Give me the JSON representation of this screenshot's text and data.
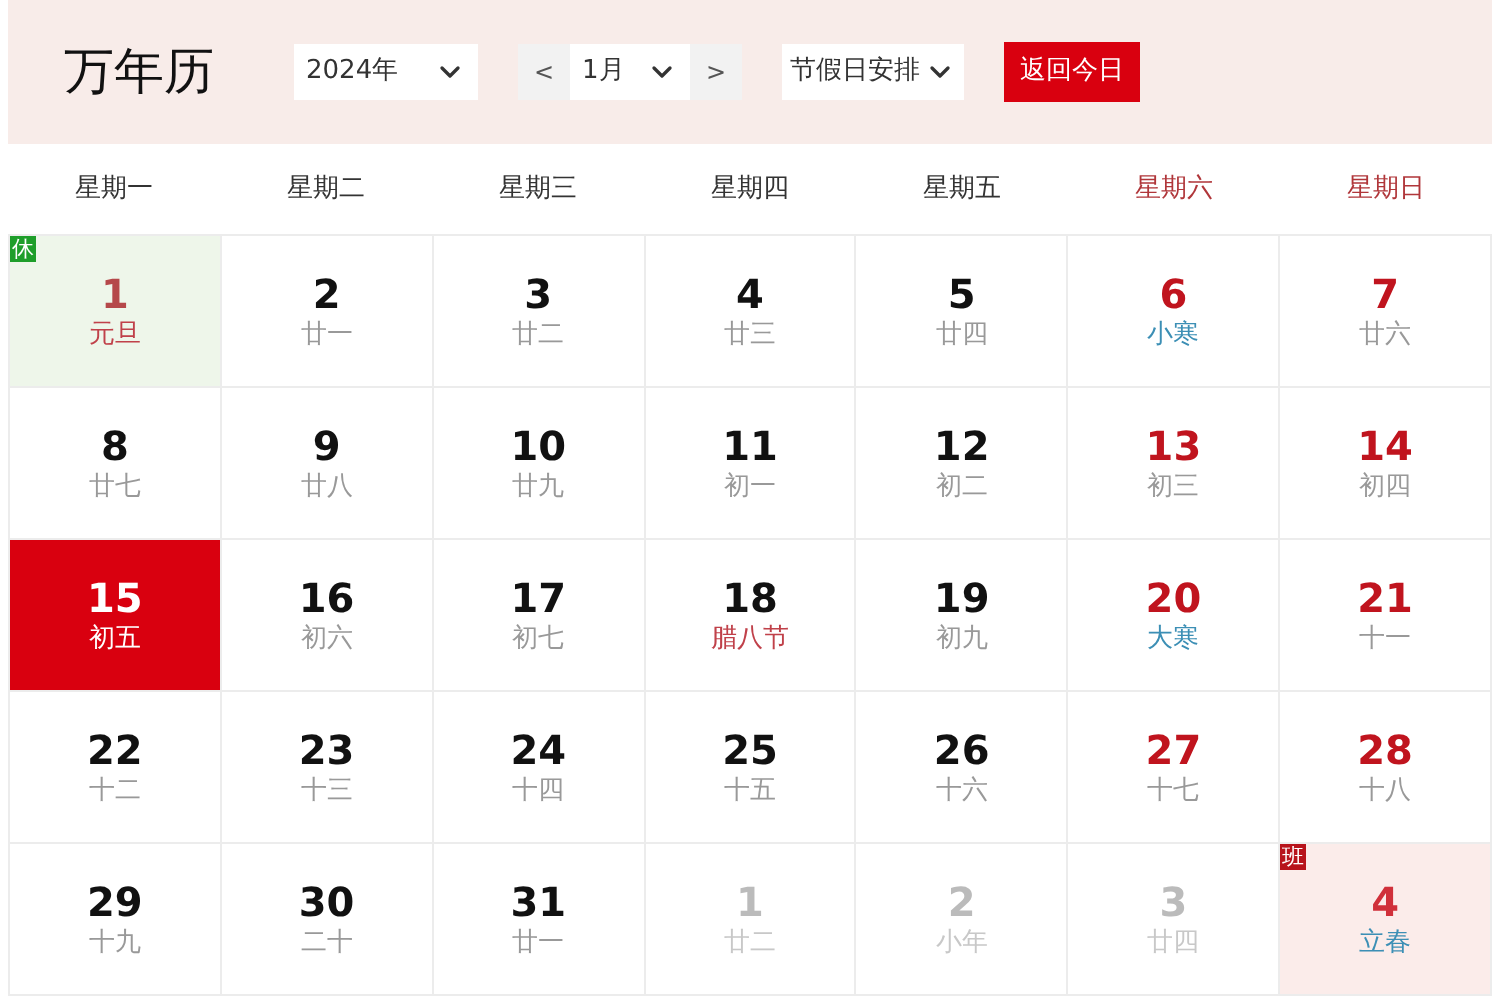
{
  "title": "万年历",
  "year_select": {
    "value": "2024年"
  },
  "month_nav": {
    "prev": "<",
    "value": "1月",
    "next": ">"
  },
  "holiday_select": {
    "value": "节假日安排"
  },
  "today_button": "返回今日",
  "weekdays": [
    {
      "label": "星期一",
      "weekend": false
    },
    {
      "label": "星期二",
      "weekend": false
    },
    {
      "label": "星期三",
      "weekend": false
    },
    {
      "label": "星期四",
      "weekend": false
    },
    {
      "label": "星期五",
      "weekend": false
    },
    {
      "label": "星期六",
      "weekend": true
    },
    {
      "label": "星期日",
      "weekend": true
    }
  ],
  "days": [
    {
      "day": "1",
      "lunar": "元旦",
      "festival": true,
      "solar_term": false,
      "weekend": false,
      "other_month": false,
      "selected": false,
      "badge": {
        "text": "休",
        "kind": "rest"
      }
    },
    {
      "day": "2",
      "lunar": "廿一",
      "festival": false,
      "solar_term": false,
      "weekend": false,
      "other_month": false,
      "selected": false
    },
    {
      "day": "3",
      "lunar": "廿二",
      "festival": false,
      "solar_term": false,
      "weekend": false,
      "other_month": false,
      "selected": false
    },
    {
      "day": "4",
      "lunar": "廿三",
      "festival": false,
      "solar_term": false,
      "weekend": false,
      "other_month": false,
      "selected": false
    },
    {
      "day": "5",
      "lunar": "廿四",
      "festival": false,
      "solar_term": false,
      "weekend": false,
      "other_month": false,
      "selected": false
    },
    {
      "day": "6",
      "lunar": "小寒",
      "festival": false,
      "solar_term": true,
      "weekend": true,
      "other_month": false,
      "selected": false
    },
    {
      "day": "7",
      "lunar": "廿六",
      "festival": false,
      "solar_term": false,
      "weekend": true,
      "other_month": false,
      "selected": false
    },
    {
      "day": "8",
      "lunar": "廿七",
      "festival": false,
      "solar_term": false,
      "weekend": false,
      "other_month": false,
      "selected": false
    },
    {
      "day": "9",
      "lunar": "廿八",
      "festival": false,
      "solar_term": false,
      "weekend": false,
      "other_month": false,
      "selected": false
    },
    {
      "day": "10",
      "lunar": "廿九",
      "festival": false,
      "solar_term": false,
      "weekend": false,
      "other_month": false,
      "selected": false
    },
    {
      "day": "11",
      "lunar": "初一",
      "festival": false,
      "solar_term": false,
      "weekend": false,
      "other_month": false,
      "selected": false
    },
    {
      "day": "12",
      "lunar": "初二",
      "festival": false,
      "solar_term": false,
      "weekend": false,
      "other_month": false,
      "selected": false
    },
    {
      "day": "13",
      "lunar": "初三",
      "festival": false,
      "solar_term": false,
      "weekend": true,
      "other_month": false,
      "selected": false
    },
    {
      "day": "14",
      "lunar": "初四",
      "festival": false,
      "solar_term": false,
      "weekend": true,
      "other_month": false,
      "selected": false
    },
    {
      "day": "15",
      "lunar": "初五",
      "festival": false,
      "solar_term": false,
      "weekend": false,
      "other_month": false,
      "selected": true
    },
    {
      "day": "16",
      "lunar": "初六",
      "festival": false,
      "solar_term": false,
      "weekend": false,
      "other_month": false,
      "selected": false
    },
    {
      "day": "17",
      "lunar": "初七",
      "festival": false,
      "solar_term": false,
      "weekend": false,
      "other_month": false,
      "selected": false
    },
    {
      "day": "18",
      "lunar": "腊八节",
      "festival": true,
      "solar_term": false,
      "weekend": false,
      "other_month": false,
      "selected": false
    },
    {
      "day": "19",
      "lunar": "初九",
      "festival": false,
      "solar_term": false,
      "weekend": false,
      "other_month": false,
      "selected": false
    },
    {
      "day": "20",
      "lunar": "大寒",
      "festival": false,
      "solar_term": true,
      "weekend": true,
      "other_month": false,
      "selected": false
    },
    {
      "day": "21",
      "lunar": "十一",
      "festival": false,
      "solar_term": false,
      "weekend": true,
      "other_month": false,
      "selected": false
    },
    {
      "day": "22",
      "lunar": "十二",
      "festival": false,
      "solar_term": false,
      "weekend": false,
      "other_month": false,
      "selected": false
    },
    {
      "day": "23",
      "lunar": "十三",
      "festival": false,
      "solar_term": false,
      "weekend": false,
      "other_month": false,
      "selected": false
    },
    {
      "day": "24",
      "lunar": "十四",
      "festival": false,
      "solar_term": false,
      "weekend": false,
      "other_month": false,
      "selected": false
    },
    {
      "day": "25",
      "lunar": "十五",
      "festival": false,
      "solar_term": false,
      "weekend": false,
      "other_month": false,
      "selected": false
    },
    {
      "day": "26",
      "lunar": "十六",
      "festival": false,
      "solar_term": false,
      "weekend": false,
      "other_month": false,
      "selected": false
    },
    {
      "day": "27",
      "lunar": "十七",
      "festival": false,
      "solar_term": false,
      "weekend": true,
      "other_month": false,
      "selected": false
    },
    {
      "day": "28",
      "lunar": "十八",
      "festival": false,
      "solar_term": false,
      "weekend": true,
      "other_month": false,
      "selected": false
    },
    {
      "day": "29",
      "lunar": "十九",
      "festival": false,
      "solar_term": false,
      "weekend": false,
      "other_month": false,
      "selected": false
    },
    {
      "day": "30",
      "lunar": "二十",
      "festival": false,
      "solar_term": false,
      "weekend": false,
      "other_month": false,
      "selected": false
    },
    {
      "day": "31",
      "lunar": "廿一",
      "festival": false,
      "solar_term": false,
      "weekend": false,
      "other_month": false,
      "selected": false
    },
    {
      "day": "1",
      "lunar": "廿二",
      "festival": false,
      "solar_term": false,
      "weekend": false,
      "other_month": true,
      "selected": false
    },
    {
      "day": "2",
      "lunar": "小年",
      "festival": false,
      "solar_term": false,
      "weekend": false,
      "other_month": true,
      "selected": false
    },
    {
      "day": "3",
      "lunar": "廿四",
      "festival": false,
      "solar_term": false,
      "weekend": true,
      "other_month": true,
      "selected": false
    },
    {
      "day": "4",
      "lunar": "立春",
      "festival": false,
      "solar_term": true,
      "weekend": true,
      "other_month": true,
      "selected": false,
      "badge": {
        "text": "班",
        "kind": "work"
      }
    }
  ]
}
